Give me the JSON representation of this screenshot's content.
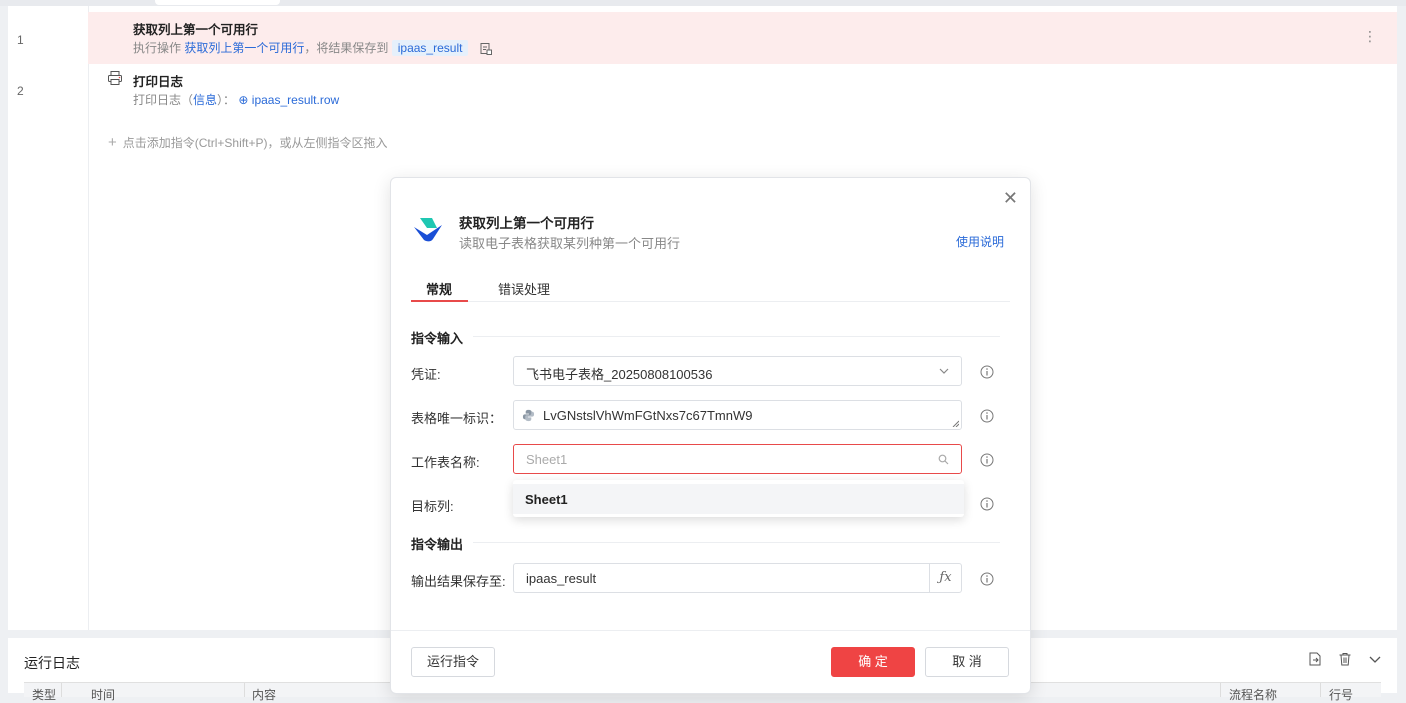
{
  "editor": {
    "steps": [
      {
        "line": "1",
        "title": "获取列上第一个可用行",
        "sub_prefix": "执行操作",
        "sub_action": "获取列上第一个可用行",
        "sub_middle": "，将结果保存到",
        "sub_var": "ipaas_result"
      },
      {
        "line": "2",
        "title": "打印日志",
        "sub_prefix": "打印日志（",
        "sub_level": "信息",
        "sub_middle": "）：",
        "sub_var": "ipaas_result.row"
      }
    ],
    "add_hint": "点击添加指令(Ctrl+Shift+P)，或从左侧指令区拖入",
    "more_icon": "kebab-icon"
  },
  "log": {
    "title": "运行日志",
    "columns": [
      "类型",
      "时间",
      "内容",
      "流程名称",
      "行号"
    ]
  },
  "dialog": {
    "title": "获取列上第一个可用行",
    "subtitle": "读取电子表格获取某列种第一个可用行",
    "help": "使用说明",
    "tabs": [
      "常规",
      "错误处理"
    ],
    "section_input": "指令输入",
    "section_output": "指令输出",
    "fields": {
      "credential_label": "凭证:",
      "credential_value": "飞书电子表格_20250808100536",
      "sheet_id_label": "表格唯一标识：",
      "sheet_id_value": "LvGNstslVhWmFGtNxs7c67TmnW9",
      "sheet_name_label": "工作表名称:",
      "sheet_name_placeholder": "Sheet1",
      "target_col_label": "目标列:",
      "output_label": "输出结果保存至:",
      "output_value": "ipaas_result"
    },
    "dropdown_options": [
      "Sheet1"
    ],
    "buttons": {
      "run": "运行指令",
      "confirm": "确 定",
      "cancel": "取 消"
    },
    "colors": {
      "accent": "#ef4444",
      "link": "#2a6ad8"
    }
  }
}
